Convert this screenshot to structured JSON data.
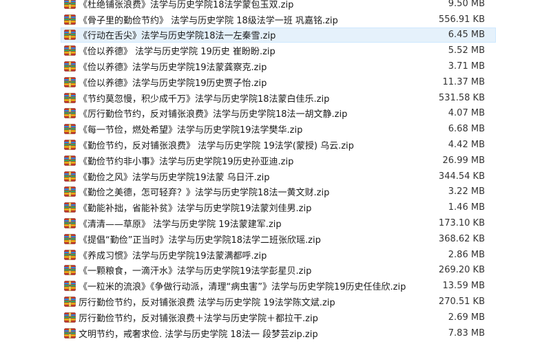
{
  "files": [
    {
      "name": "《杜绝铺张浪费》法学与历史学院18法学蒙包玉双.zip",
      "size": "9.50 MB"
    },
    {
      "name": "《骨子里的勤俭节约》 法学与历史学院 18级法学一班 巩嘉铭.zip",
      "size": "556.91 KB"
    },
    {
      "name": "《行动在舌尖》法学与历史学院18法一左秦雪.zip",
      "size": "6.45 MB",
      "selected": true
    },
    {
      "name": "《俭以养德》 法学与历史学院 19历史 崔盼盼.zip",
      "size": "5.52 MB"
    },
    {
      "name": "《俭以养德》法学与历史学院19法蒙龚察克.zip",
      "size": "3.71 MB"
    },
    {
      "name": "《俭以养德》法学与历史学院19历史贾子怡.zip",
      "size": "11.37 MB"
    },
    {
      "name": "《节约莫忽慢，积少成千万》法学与历史学院18法蒙白佳乐.zip",
      "size": "531.58 KB"
    },
    {
      "name": "《厉行勤俭节约，反对铺张浪费》法学与历史学院18法一胡文静.zip",
      "size": "4.07 MB"
    },
    {
      "name": "《每一节俭，燃处希望》法学与历史学院19法学樊华.zip",
      "size": "6.68 MB"
    },
    {
      "name": "《勤俭节约，反对铺张浪费》 法学与历史学院 19法学(蒙授) 乌云.zip",
      "size": "4.42 MB"
    },
    {
      "name": "《勤俭节约非小事》法学与历史学院19历史孙亚迪.zip",
      "size": "26.99 MB"
    },
    {
      "name": "《勤俭之风》法学与历史学院19法蒙 乌日汗.zip",
      "size": "344.54 KB"
    },
    {
      "name": "《勤俭之美德，怎可轻弃？》法学与历史学院18法一黄文财.zip",
      "size": "3.22 MB"
    },
    {
      "name": "《勤能补拙，省能补贫》法学与历史学院19法蒙刘佳男.zip",
      "size": "1.46 MB"
    },
    {
      "name": "《清清——草原》  法学与历史学院  19法蒙建军.zip",
      "size": "173.10 KB"
    },
    {
      "name": "《提倡“勤俭”正当时》法学与历史学院18法学二班张欣瑶.zip",
      "size": "368.62 KB"
    },
    {
      "name": "《养成习惯》法学与历史学院19法蒙满都呼.zip",
      "size": "2.86 MB"
    },
    {
      "name": "《一颗粮食，一滴汗水》法学与历史学院19法学彭星贝.zip",
      "size": "269.20 KB"
    },
    {
      "name": "《一粒米的流浪》《争做行动派，清理“病虫害”》法学与历史学院19历史任佳欣.zip",
      "size": "13.59 MB"
    },
    {
      "name": "厉行勤俭节约，反对铺张浪费   法学与历史学院    19法学陈文斌.zip",
      "size": "270.51 KB"
    },
    {
      "name": "厉行勤俭节约，反对铺张浪费＋法学与历史学院＋都拉干.zip",
      "size": "2.69 MB"
    },
    {
      "name": "文明节约，戒奢求俭. 法学与历史学院 18法一 段梦芸zip.zip",
      "size": "7.83 MB"
    }
  ]
}
